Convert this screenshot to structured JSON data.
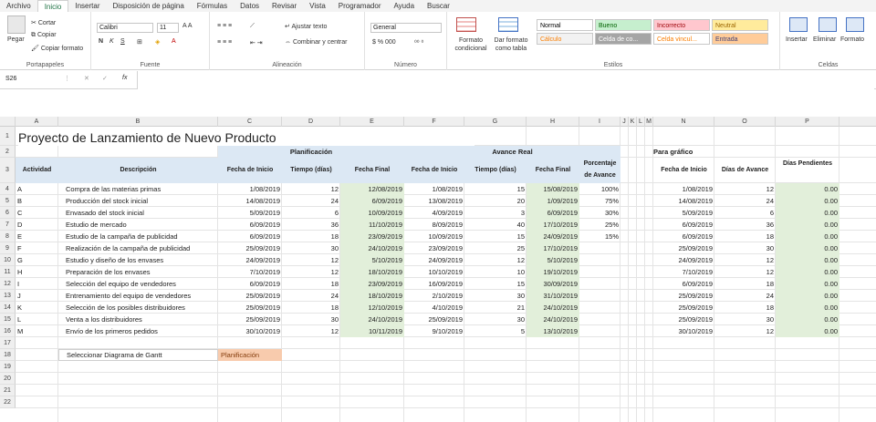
{
  "ribbon_tabs": [
    "Archivo",
    "Inicio",
    "Insertar",
    "Disposición de página",
    "Fórmulas",
    "Datos",
    "Revisar",
    "Vista",
    "Programador",
    "Ayuda",
    "Buscar"
  ],
  "clipboard": {
    "paste": "Pegar",
    "cut": "Cortar",
    "copy": "Copiar",
    "format_painter": "Copiar formato",
    "label": "Portapapeles"
  },
  "font": {
    "name": "Calibri",
    "size": "11",
    "label": "Fuente"
  },
  "alignment": {
    "wrap": "Ajustar texto",
    "merge": "Combinar y centrar",
    "label": "Alineación"
  },
  "number": {
    "format": "General",
    "label": "Número"
  },
  "styles": {
    "cond_format": "Formato condicional",
    "table_format": "Dar formato como tabla",
    "items": [
      {
        "name": "Normal",
        "bg": "#ffffff",
        "fg": "#000000"
      },
      {
        "name": "Bueno",
        "bg": "#c6efce",
        "fg": "#006100"
      },
      {
        "name": "Incorrecto",
        "bg": "#ffc7ce",
        "fg": "#9c0006"
      },
      {
        "name": "Neutral",
        "bg": "#ffeb9c",
        "fg": "#9c6500"
      },
      {
        "name": "Cálculo",
        "bg": "#f2f2f2",
        "fg": "#fa7d00"
      },
      {
        "name": "Celda de co...",
        "bg": "#a5a5a5",
        "fg": "#ffffff"
      },
      {
        "name": "Celda vincul...",
        "bg": "#ffffff",
        "fg": "#fa7d00"
      },
      {
        "name": "Entrada",
        "bg": "#ffcc99",
        "fg": "#3f3f76"
      }
    ],
    "label": "Estilos"
  },
  "cells_group": {
    "insert": "Insertar",
    "delete": "Eliminar",
    "format": "Formato",
    "label": "Celdas"
  },
  "formula_bar": {
    "namebox": "S26",
    "fx": "fx",
    "content": ""
  },
  "columns": [
    "A",
    "B",
    "C",
    "D",
    "E",
    "F",
    "G",
    "H",
    "I",
    "J",
    "K",
    "L",
    "M",
    "N",
    "O",
    "P"
  ],
  "rows": [
    "1",
    "2",
    "3",
    "4",
    "5",
    "6",
    "7",
    "8",
    "9",
    "10",
    "11",
    "12",
    "13",
    "14",
    "15",
    "16",
    "17",
    "18",
    "19",
    "20",
    "21",
    "22"
  ],
  "sheet": {
    "title": "Proyecto de Lanzamiento de Nuevo Producto",
    "planificacion": "Planificación",
    "avance": "Avance Real",
    "grafico": "Para gráfico",
    "headers": [
      "Actividad",
      "Descripción",
      "Fecha de Inicio",
      "Tiempo (días)",
      "Fecha Final",
      "Fecha de Inicio",
      "Tiempo (días)",
      "Fecha Final",
      "Porcentaje de Avance"
    ],
    "graf_headers": [
      "Fecha de Inicio",
      "Días de Avance",
      "Días Pendientes"
    ],
    "tasks": [
      [
        "A",
        "Compra de las materias primas",
        "1/08/2019",
        "12",
        "12/08/2019",
        "1/08/2019",
        "15",
        "15/08/2019",
        "100%"
      ],
      [
        "B",
        "Producción del stock inicial",
        "14/08/2019",
        "24",
        "6/09/2019",
        "13/08/2019",
        "20",
        "1/09/2019",
        "75%"
      ],
      [
        "C",
        "Envasado del stock inicial",
        "5/09/2019",
        "6",
        "10/09/2019",
        "4/09/2019",
        "3",
        "6/09/2019",
        "30%"
      ],
      [
        "D",
        "Estudio de mercado",
        "6/09/2019",
        "36",
        "11/10/2019",
        "8/09/2019",
        "40",
        "17/10/2019",
        "25%"
      ],
      [
        "E",
        "Estudio de la campaña de publicidad",
        "6/09/2019",
        "18",
        "23/09/2019",
        "10/09/2019",
        "15",
        "24/09/2019",
        "15%"
      ],
      [
        "F",
        "Realización de la campaña de publicidad",
        "25/09/2019",
        "30",
        "24/10/2019",
        "23/09/2019",
        "25",
        "17/10/2019",
        ""
      ],
      [
        "G",
        "Estudio y diseño de los envases",
        "24/09/2019",
        "12",
        "5/10/2019",
        "24/09/2019",
        "12",
        "5/10/2019",
        ""
      ],
      [
        "H",
        "Preparación de los envases",
        "7/10/2019",
        "12",
        "18/10/2019",
        "10/10/2019",
        "10",
        "19/10/2019",
        ""
      ],
      [
        "I",
        "Selección del equipo de vendedores",
        "6/09/2019",
        "18",
        "23/09/2019",
        "16/09/2019",
        "15",
        "30/09/2019",
        ""
      ],
      [
        "J",
        "Entrenamiento del equipo de vendedores",
        "25/09/2019",
        "24",
        "18/10/2019",
        "2/10/2019",
        "30",
        "31/10/2019",
        ""
      ],
      [
        "K",
        "Selección de los posibles distribuidores",
        "25/09/2019",
        "18",
        "12/10/2019",
        "4/10/2019",
        "21",
        "24/10/2019",
        ""
      ],
      [
        "L",
        "Venta a los distribuidores",
        "25/09/2019",
        "30",
        "24/10/2019",
        "25/09/2019",
        "30",
        "24/10/2019",
        ""
      ],
      [
        "M",
        "Envío de los primeros pedidos",
        "30/10/2019",
        "12",
        "10/11/2019",
        "9/10/2019",
        "5",
        "13/10/2019",
        ""
      ]
    ],
    "graf": [
      [
        "1/08/2019",
        "12",
        "0.00"
      ],
      [
        "14/08/2019",
        "24",
        "0.00"
      ],
      [
        "5/09/2019",
        "6",
        "0.00"
      ],
      [
        "6/09/2019",
        "36",
        "0.00"
      ],
      [
        "6/09/2019",
        "18",
        "0.00"
      ],
      [
        "25/09/2019",
        "30",
        "0.00"
      ],
      [
        "24/09/2019",
        "12",
        "0.00"
      ],
      [
        "7/10/2019",
        "12",
        "0.00"
      ],
      [
        "6/09/2019",
        "18",
        "0.00"
      ],
      [
        "25/09/2019",
        "24",
        "0.00"
      ],
      [
        "25/09/2019",
        "18",
        "0.00"
      ],
      [
        "25/09/2019",
        "30",
        "0.00"
      ],
      [
        "30/10/2019",
        "12",
        "0.00"
      ]
    ],
    "select_label": "Seleccionar Diagrama de Gantt",
    "select_value": "Planificación"
  }
}
